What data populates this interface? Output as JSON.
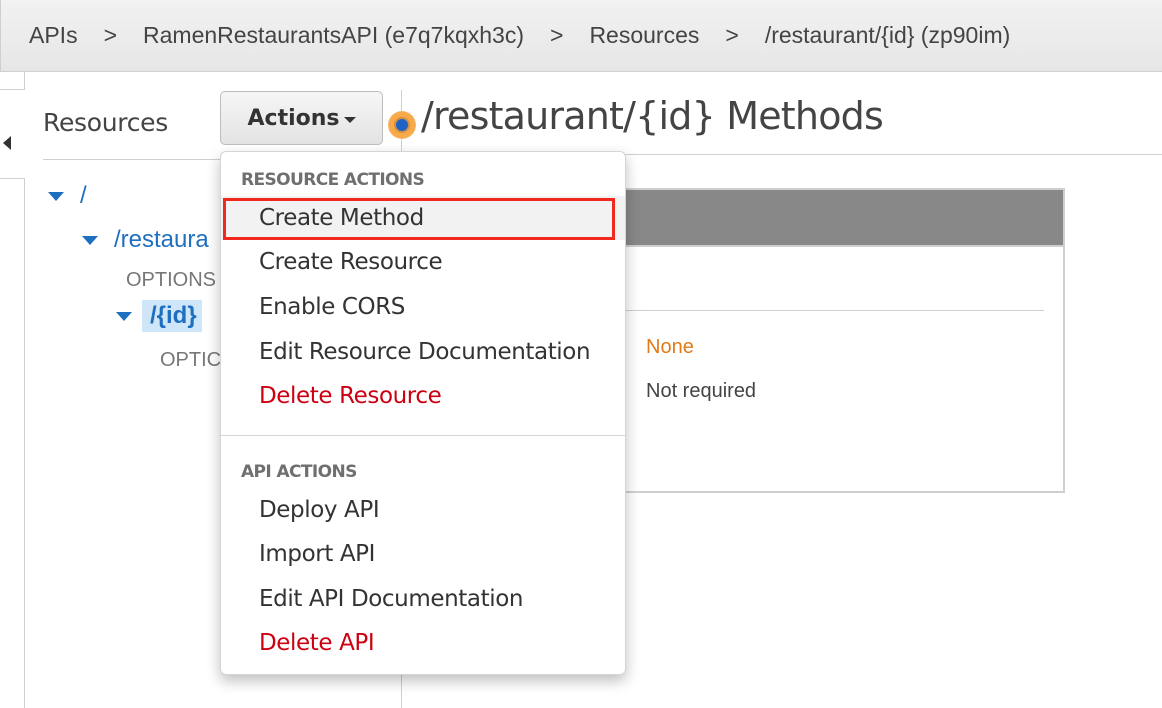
{
  "breadcrumb": {
    "items": [
      {
        "label": "APIs"
      },
      {
        "label": "RamenRestaurantsAPI (e7q7kqxh3c)"
      },
      {
        "label": "Resources"
      },
      {
        "label": "/restaurant/{id} (zp90im)"
      }
    ],
    "separator": ">"
  },
  "sidebar": {
    "title": "Resources",
    "actions_button": "Actions",
    "tree": [
      {
        "label": "/",
        "type": "resource",
        "expanded": true
      },
      {
        "label": "/restaura",
        "type": "resource",
        "expanded": true
      },
      {
        "label": "OPTIONS",
        "type": "method"
      },
      {
        "label": "/{id}",
        "type": "resource",
        "expanded": true,
        "selected": true
      },
      {
        "label": "OPTIC",
        "type": "method"
      }
    ]
  },
  "main": {
    "title": "/restaurant/{id} Methods",
    "card": {
      "colon_fragment": ":",
      "authorization_value": "None",
      "api_key_value": "Not required"
    }
  },
  "actions_menu": {
    "sections": [
      {
        "label": "RESOURCE ACTIONS",
        "items": [
          {
            "label": "Create Method",
            "highlighted": true
          },
          {
            "label": "Create Resource"
          },
          {
            "label": "Enable CORS"
          },
          {
            "label": "Edit Resource Documentation"
          },
          {
            "label": "Delete Resource",
            "danger": true
          }
        ]
      },
      {
        "label": "API ACTIONS",
        "items": [
          {
            "label": "Deploy API"
          },
          {
            "label": "Import API"
          },
          {
            "label": "Edit API Documentation"
          },
          {
            "label": "Delete API",
            "danger": true
          }
        ]
      }
    ]
  },
  "colors": {
    "link": "#1f6fc0",
    "danger": "#cc0011",
    "warning": "#e07b17",
    "highlight_border": "#f0281e",
    "card_header": "#888888"
  }
}
